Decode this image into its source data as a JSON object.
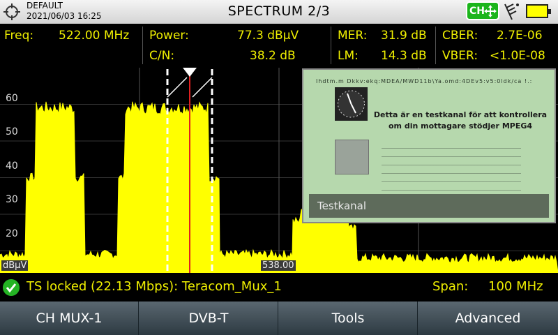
{
  "header": {
    "profile": "DEFAULT",
    "datetime": "2021/06/03 16:25",
    "title": "SPECTRUM 2/3",
    "ch_badge": "CH",
    "colors": {
      "badge": "#1bb51b",
      "battery": "#ffff00"
    }
  },
  "measurements": {
    "freq_label": "Freq:",
    "freq_value": "522.00 MHz",
    "power_label": "Power:",
    "power_value": "77.3 dBµV",
    "cn_label": "C/N:",
    "cn_value": "38.2 dB",
    "mer_label": "MER:",
    "mer_value": "31.9 dB",
    "lm_label": "LM:",
    "lm_value": "14.3 dB",
    "cber_label": "CBER:",
    "cber_value": "2.7E-06",
    "vber_label": "VBER:",
    "vber_value": "<1.0E-08"
  },
  "plot": {
    "y_ticks": [
      "60",
      "50",
      "40",
      "30",
      "20"
    ],
    "unit": "dBµV",
    "center_freq": "538.00",
    "colors": {
      "trace": "#ffff00",
      "marker": "#e02020"
    }
  },
  "chart_data": {
    "type": "area",
    "ylim": [
      14,
      70
    ],
    "ylabel": "dBµV",
    "center_x_label": "538.00",
    "segments": [
      {
        "x0": 0,
        "x1": 38,
        "level": 19
      },
      {
        "x0": 38,
        "x1": 52,
        "level": 40
      },
      {
        "x0": 52,
        "x1": 108,
        "level": 59
      },
      {
        "x0": 108,
        "x1": 122,
        "level": 40
      },
      {
        "x0": 122,
        "x1": 170,
        "level": 19
      },
      {
        "x0": 170,
        "x1": 180,
        "level": 40
      },
      {
        "x0": 180,
        "x1": 300,
        "level": 59
      },
      {
        "x0": 300,
        "x1": 315,
        "level": 40
      },
      {
        "x0": 315,
        "x1": 420,
        "level": 19
      },
      {
        "x0": 420,
        "x1": 432,
        "level": 28
      },
      {
        "x0": 432,
        "x1": 500,
        "level": 32
      },
      {
        "x0": 500,
        "x1": 512,
        "level": 26
      },
      {
        "x0": 512,
        "x1": 800,
        "level": 18
      }
    ]
  },
  "video": {
    "header_text": "Ihdtm.m    Dkkv:ekq:MDEA/MWD11b\\Ya.omd:4DEv5:v5:0ldk/ca    !.:",
    "heading_line1": "Detta är en testkanal för att kontrollera",
    "heading_line2": "om din mottagare stödjer MPEG4",
    "caption": "Testkanal"
  },
  "status": {
    "message": "TS locked (22.13 Mbps): Teracom_Mux_1",
    "span_label": "Span:",
    "span_value": "100 MHz"
  },
  "buttons": {
    "b1": "CH MUX-1",
    "b2": "DVB-T",
    "b3": "Tools",
    "b4": "Advanced"
  }
}
